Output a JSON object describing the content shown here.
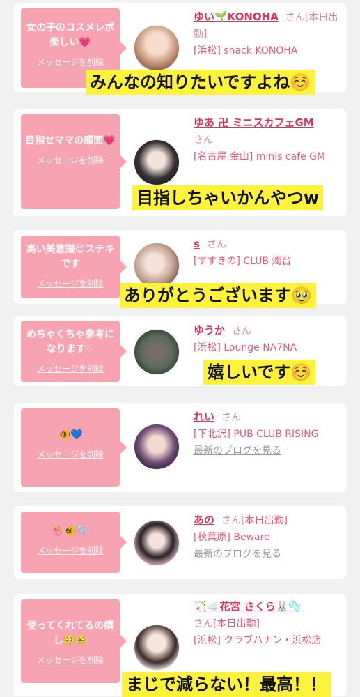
{
  "delete_label": "メッセージを削除",
  "blog_label": "最新のブログを見る",
  "san_label": "さん",
  "colors": {
    "bubble": "#f7a3b2",
    "name": "#d8345f",
    "caption_bg": "#fff23a"
  },
  "cards": [
    {
      "message": "女の子のコスメレポ楽しい💗",
      "name": "ゆい🌱KONOHA",
      "status": "[本日出勤]",
      "shop": "[浜松] snack KONOHA",
      "caption": "みんなの知りたいですよね☺️",
      "avatar": "avatar-woman-icon"
    },
    {
      "message": "目指せママの顔面💗",
      "name": "ゆあ 卍 ミニスカフェGM",
      "status": "",
      "shop": "[名古屋 金山] minis cafe GM",
      "caption": "目指しちゃいかんやつw",
      "avatar": "avatar-woman-icon"
    },
    {
      "message": "高い美意識😍ステキです",
      "name": "s",
      "status": "",
      "shop": "[すすきの] CLUB 燭台",
      "caption": "ありがとうございます🥹",
      "avatar": "avatar-woman-icon"
    },
    {
      "message": "めちゃくちゃ参考になります♡",
      "name": "ゆうか",
      "status": "",
      "shop": "[浜松] Lounge NA7NA",
      "caption": "嬉しいです☺️",
      "avatar": "avatar-woman-icon"
    },
    {
      "message": "🐠💙",
      "name": "れい",
      "status": "",
      "shop": "[下北沢] PUB CLUB RISING",
      "caption": "",
      "avatar": "avatar-woman-icon"
    },
    {
      "message": "🪼🐠🫧",
      "name": "あの",
      "status": "[本日出勤]",
      "shop": "[秋葉原] Beware",
      "caption": "",
      "avatar": "avatar-woman-icon"
    },
    {
      "message": "使ってくれてるの嬉し🥹🥹",
      "name": "🏹☁️花宮 さくら🐰🫧",
      "status": "[本日出勤]",
      "shop": "[浜松] クラブハナン・浜松店",
      "caption": "まじで減らない！最高！！",
      "avatar": "avatar-woman-icon"
    }
  ]
}
